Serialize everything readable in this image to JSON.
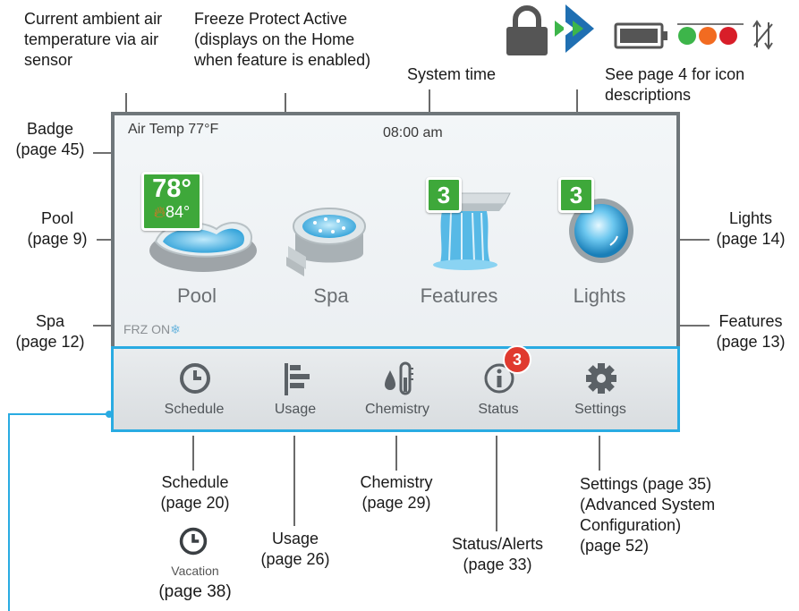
{
  "annotations": {
    "air_temp": [
      "Current ambient air",
      "temperature via air",
      "sensor"
    ],
    "freeze": [
      "Freeze Protect Active",
      "(displays on the Home",
      "when feature is enabled)"
    ],
    "system_time": "System time",
    "icon_desc": [
      "See page 4 for icon",
      "descriptions"
    ],
    "badge": [
      "Badge",
      "(page 45)"
    ],
    "pool": [
      "Pool",
      "(page 9)"
    ],
    "spa": [
      "Spa",
      "(page 12)"
    ],
    "lights": [
      "Lights",
      "(page 14)"
    ],
    "features": [
      "Features",
      "(page 13)"
    ],
    "schedule": [
      "Schedule",
      "(page 20)"
    ],
    "vacation_label": "Vacation",
    "vacation_page": "(page 38)",
    "usage": [
      "Usage",
      "(page 26)"
    ],
    "chemistry": [
      "Chemistry",
      "(page 29)"
    ],
    "status": [
      "Status/Alerts",
      "(page 33)"
    ],
    "settings": [
      "Settings (page 35)",
      "(Advanced System",
      "Configuration)",
      "(page 52)"
    ]
  },
  "screen": {
    "air_temp": "Air Temp 77°F",
    "time": "08:00 am",
    "frz": "FRZ ON",
    "tiles": [
      {
        "label": "Pool",
        "icon": "pool-icon"
      },
      {
        "label": "Spa",
        "icon": "spa-icon"
      },
      {
        "label": "Features",
        "icon": "waterfall-icon"
      },
      {
        "label": "Lights",
        "icon": "light-icon"
      }
    ],
    "pool_badge": {
      "temp": "78°",
      "set": "84°"
    },
    "features_badge": "3",
    "lights_badge": "3",
    "nav": [
      {
        "label": "Schedule",
        "icon": "clock-icon"
      },
      {
        "label": "Usage",
        "icon": "usage-icon"
      },
      {
        "label": "Chemistry",
        "icon": "chemistry-icon"
      },
      {
        "label": "Status",
        "icon": "info-icon"
      },
      {
        "label": "Settings",
        "icon": "gear-icon"
      }
    ],
    "status_alert_count": "3"
  },
  "colors": {
    "badge_green": "#3ea83a",
    "nav_border": "#29abe2",
    "alert_red": "#e03a2f"
  }
}
